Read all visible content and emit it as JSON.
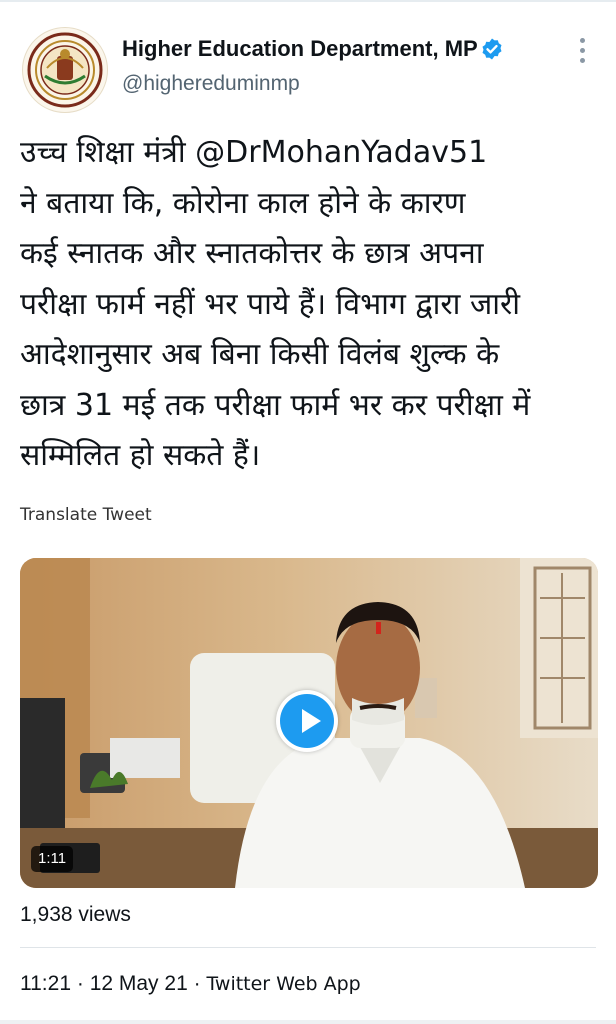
{
  "tweet": {
    "author": {
      "display_name": "Higher Education Department, MP",
      "handle": "@highereduminmp",
      "verified": true,
      "avatar_icon": "mp-govt-emblem-icon"
    },
    "text": {
      "line1_prefix": "उच्च शिक्षा मंत्री ",
      "mention": "@DrMohanYadav51",
      "line2": "ने बताया कि, कोरोना काल होने के कारण",
      "line3": "कई स्नातक और स्नातकोत्तर के छात्र अपना",
      "line4": "परीक्षा फार्म नहीं भर पाये हैं। विभाग द्वारा जारी",
      "line5": "आदेशानुसार अब बिना किसी विलंब शुल्क के",
      "line6": "छात्र 31 मई तक परीक्षा फार्म भर कर परीक्षा में",
      "line7": "सम्मिलित हो सकते हैं।"
    },
    "translate_label": "Translate Tweet",
    "video": {
      "duration": "1:11",
      "play_icon": "play-icon"
    },
    "views": "1,938 views",
    "time": "11:21",
    "date": "12 May 21",
    "separator": "·",
    "source": "Twitter Web App"
  },
  "colors": {
    "verified": "#1d9bf0",
    "play": "#1d9bf0",
    "text": "#0f1419",
    "secondary": "#536471"
  }
}
